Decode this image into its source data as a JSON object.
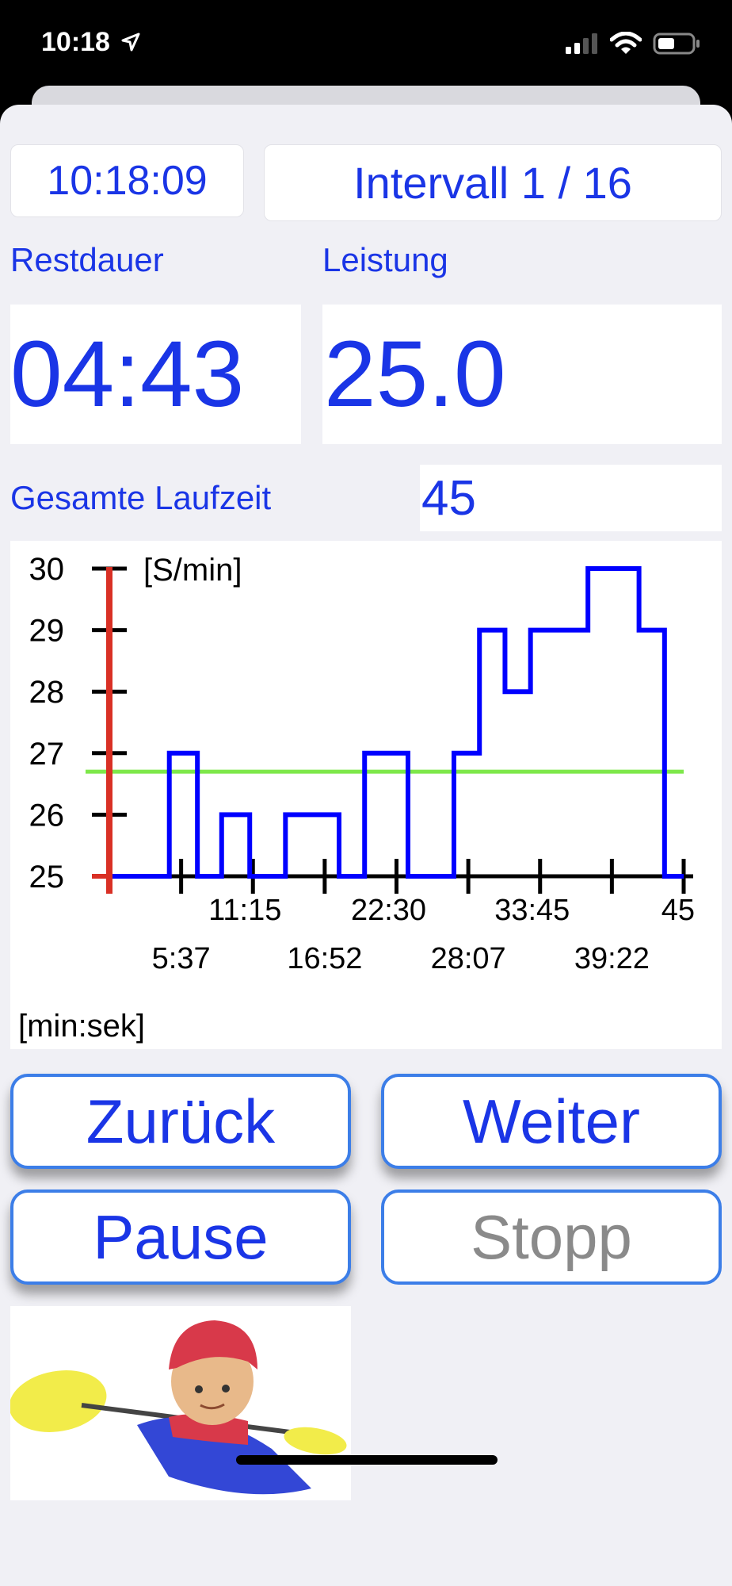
{
  "status_bar": {
    "time": "10:18",
    "location_icon": "location-arrow-icon",
    "signal_icon": "cellular-signal-icon",
    "wifi_icon": "wifi-icon",
    "battery_icon": "battery-icon"
  },
  "header": {
    "clock": "10:18:09",
    "interval": "Intervall 1 / 16"
  },
  "stats": {
    "rest_label": "Restdauer",
    "rest_value": "04:43",
    "performance_label": "Leistung",
    "performance_value": "25.0",
    "total_label": "Gesamte Laufzeit",
    "total_value": "45"
  },
  "colors": {
    "accent": "#1a35e6",
    "button_border": "#3c7ee8",
    "chart_series": "#0000ff",
    "chart_target": "#7ee84a",
    "chart_current": "#d93025",
    "disabled_text": "#8a8a8a"
  },
  "chart_data": {
    "type": "line",
    "step": true,
    "ylabel": "[S/min]",
    "xlabel": "[min:sek]",
    "ylim": [
      25,
      30
    ],
    "yticks": [
      "30",
      "29",
      "28",
      "27",
      "26",
      "25"
    ],
    "xlim": [
      0,
      45
    ],
    "xticks_upper": [
      "11:15",
      "22:30",
      "33:45",
      "45"
    ],
    "xticks_lower": [
      "5:37",
      "16:52",
      "28:07",
      "39:22"
    ],
    "target_level": 26.7,
    "current_time": 0,
    "series": [
      {
        "x": [
          0,
          4.7,
          4.7,
          6.9,
          6.9,
          8.8,
          8.8,
          11.0,
          11.0,
          13.8,
          13.8,
          18.0,
          18.0,
          20.0,
          20.0,
          23.4,
          23.4,
          27.0,
          27.0,
          29.0,
          29.0,
          31.0,
          31.0,
          33.0,
          33.0,
          37.5,
          37.5,
          41.5,
          41.5,
          43.5,
          43.5,
          45.0
        ],
        "y": [
          25,
          25,
          27,
          27,
          25,
          25,
          26,
          26,
          25,
          25,
          26,
          26,
          25,
          25,
          27,
          27,
          25,
          25,
          27,
          27,
          29,
          29,
          28,
          28,
          29,
          29,
          30,
          30,
          29,
          29,
          25,
          25
        ]
      }
    ]
  },
  "buttons": {
    "back": "Zurück",
    "next": "Weiter",
    "pause": "Pause",
    "stop": "Stopp"
  },
  "image": {
    "icon": "kayaker-icon"
  }
}
